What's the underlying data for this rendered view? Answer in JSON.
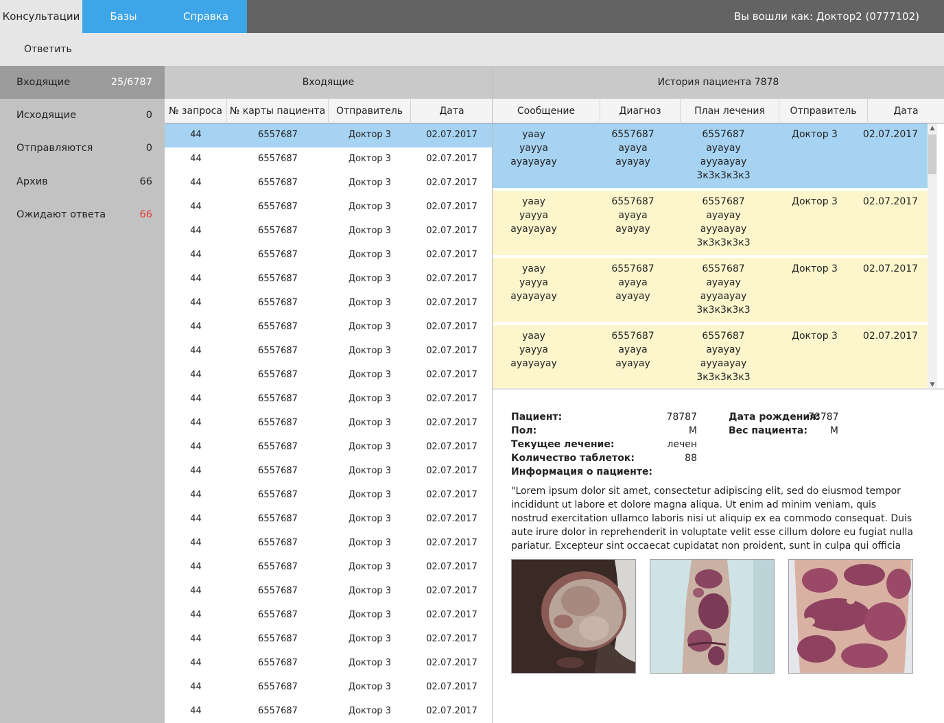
{
  "topbar": {
    "tabs": [
      "Консультации",
      "Базы",
      "Справка"
    ],
    "login": "Вы вошли как: Доктор2 (0777102)"
  },
  "toolbar": {
    "reply": "Ответить"
  },
  "sidebar": {
    "items": [
      {
        "label": "Входящие",
        "count": "25/6787"
      },
      {
        "label": "Исходящие",
        "count": "0"
      },
      {
        "label": "Отправляются",
        "count": "0"
      },
      {
        "label": "Архив",
        "count": "66"
      },
      {
        "label": "Ожидают ответа",
        "count": "66"
      }
    ]
  },
  "inbox": {
    "title": "Входящие",
    "columns": [
      "№ запроса",
      "№ карты пациента",
      "Отправитель",
      "Дата"
    ],
    "row": {
      "req": "44",
      "card": "6557687",
      "sender": "Доктор 3",
      "date": "02.07.2017"
    },
    "row_count": 25
  },
  "history": {
    "title": "История пациента 7878",
    "columns": [
      "Сообщение",
      "Диагноз",
      "План лечения",
      "Отправитель",
      "Дата"
    ],
    "rows": [
      {
        "msg": [
          "yaay",
          "yayya",
          "ayayayay"
        ],
        "diag": [
          "6557687",
          "ayaya",
          "ayayay"
        ],
        "plan": [
          "6557687",
          "ayayay",
          "ayyaayay",
          "3к3к3к3к3"
        ],
        "sender": "Доктор 3",
        "date": "02.07.2017"
      },
      {
        "msg": [
          "yaay",
          "yayya",
          "ayayayay"
        ],
        "diag": [
          "6557687",
          "ayaya",
          "ayayay"
        ],
        "plan": [
          "6557687",
          "ayayay",
          "ayyaayay",
          "3к3к3к3к3"
        ],
        "sender": "Доктор 3",
        "date": "02.07.2017"
      },
      {
        "msg": [
          "yaay",
          "yayya",
          "ayayayay"
        ],
        "diag": [
          "6557687",
          "ayaya",
          "ayayay"
        ],
        "plan": [
          "6557687",
          "ayayay",
          "ayyaayay",
          "3к3к3к3к3"
        ],
        "sender": "Доктор 3",
        "date": "02.07.2017"
      },
      {
        "msg": [
          "yaay",
          "yayya",
          "ayayayay"
        ],
        "diag": [
          "6557687",
          "ayaya",
          "ayayay"
        ],
        "plan": [
          "6557687",
          "ayayay",
          "ayyaayay",
          "3к3к3к3к3"
        ],
        "sender": "Доктор 3",
        "date": "02.07.2017"
      }
    ]
  },
  "patient": {
    "name_label": "Пациент:",
    "name_value": "78787",
    "sex_label": "Пол:",
    "sex_value": "М",
    "treat_label": "Текущее лечение:",
    "treat_value": "лечен",
    "pills_label": "Количество таблеток:",
    "pills_value": "88",
    "info_label": "Информация о пациенте:",
    "dob_label": "Дата рождения:",
    "dob_value": "78787",
    "weight_label": "Вес пациента:",
    "weight_value": "М",
    "info_text": "\"Lorem ipsum dolor sit amet, consectetur adipiscing elit, sed do eiusmod tempor incididunt ut labore et dolore magna aliqua. Ut enim ad minim veniam, quis nostrud exercitation ullamco laboris nisi ut aliquip ex ea commodo consequat. Duis aute irure dolor in reprehenderit in voluptate velit esse cillum dolore eu fugiat nulla pariatur. Excepteur sint occaecat cupidatat non proident, sunt in culpa qui officia deserunt mollit"
  },
  "colors": {
    "accent": "#3da5e8",
    "topbar": "#636363",
    "selected_row": "#a7d3f2",
    "history_row": "#fdf6cd",
    "alert": "#e53935"
  }
}
